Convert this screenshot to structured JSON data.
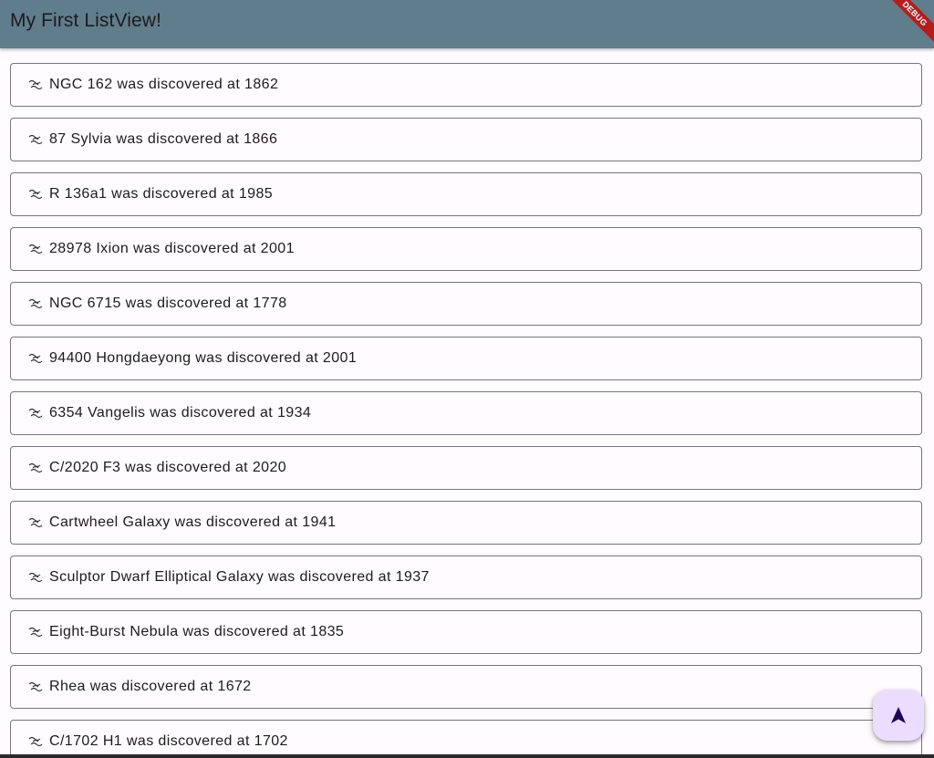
{
  "appbar": {
    "title": "My First ListView!",
    "background": "#607d8b",
    "debug_banner": "DEBUG"
  },
  "list": {
    "item_icon": "galaxy-emoji-icon",
    "items": [
      {
        "label": "NGC 162 was discovered at 1862"
      },
      {
        "label": "87 Sylvia was discovered at 1866"
      },
      {
        "label": "R 136a1 was discovered at 1985"
      },
      {
        "label": "28978 Ixion was discovered at 2001"
      },
      {
        "label": "NGC 6715 was discovered at 1778"
      },
      {
        "label": "94400 Hongdaeyong was discovered at 2001"
      },
      {
        "label": "6354 Vangelis was discovered at 1934"
      },
      {
        "label": "C/2020 F3 was discovered at 2020"
      },
      {
        "label": "Cartwheel Galaxy was discovered at 1941"
      },
      {
        "label": "Sculptor Dwarf Elliptical Galaxy was discovered at 1937"
      },
      {
        "label": "Eight-Burst Nebula was discovered at 1835"
      },
      {
        "label": "Rhea was discovered at 1672"
      },
      {
        "label": "C/1702 H1 was discovered at 1702"
      }
    ]
  },
  "fab": {
    "icon": "navigation-arrow-icon",
    "background": "#eaddff"
  }
}
